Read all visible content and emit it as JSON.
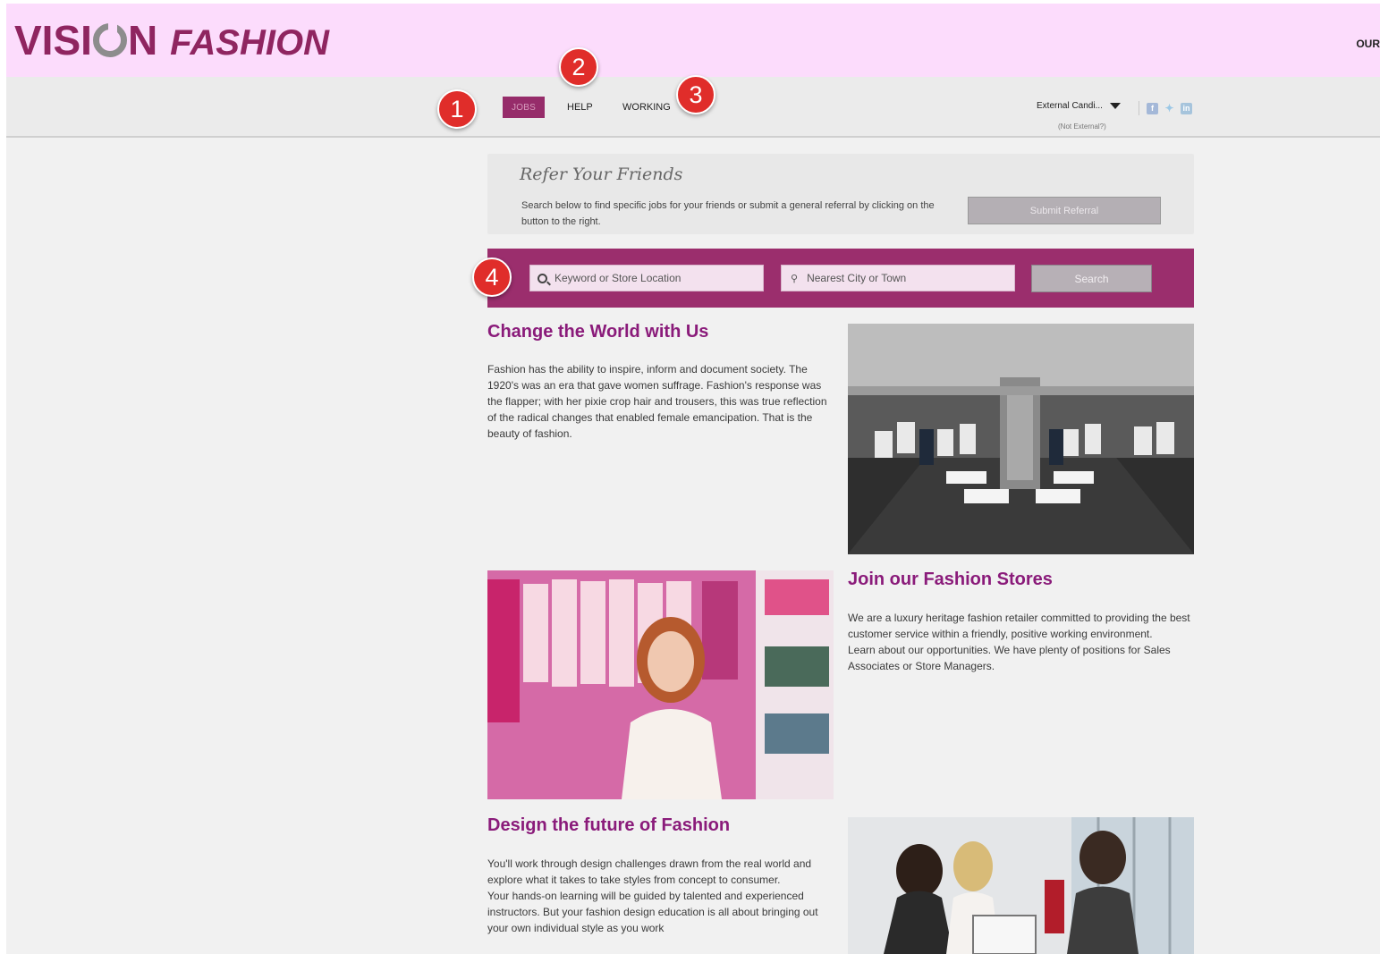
{
  "brand": {
    "name_part1": "VISI",
    "name_part2": "N",
    "name_part3": "FASHION"
  },
  "header": {
    "top_right_link": "OUR"
  },
  "nav": {
    "jobs": "JOBS",
    "help": "HELP",
    "working": "WORKING",
    "user_menu": "External Candi...",
    "not_external": "(Not External?)"
  },
  "socials": [
    "facebook-icon",
    "twitter-icon",
    "linkedin-icon"
  ],
  "markers": [
    "1",
    "2",
    "3",
    "4"
  ],
  "refer": {
    "title": "Refer Your Friends",
    "description": "Search below to find specific jobs for your friends or submit a general referral by clicking on the button to the right.",
    "button": "Submit Referral"
  },
  "search": {
    "keyword_placeholder": "Keyword or Store Location",
    "city_placeholder": "Nearest City or Town",
    "button": "Search"
  },
  "sections": [
    {
      "heading": "Change the World with Us",
      "text": "Fashion has the ability to inspire, inform and document society. The 1920's was an era that gave women suffrage. Fashion's response was the flapper; with her pixie crop hair and trousers, this was true reflection of the radical changes that enabled female emancipation. That is the beauty of fashion."
    },
    {
      "heading": "Join our Fashion Stores",
      "text1": "We are a luxury heritage fashion retailer committed to providing the best customer service within a friendly, positive working environment.",
      "text2": "Learn about our opportunities. We have plenty of positions for Sales Associates or Store Managers."
    },
    {
      "heading": "Design the future of Fashion",
      "text1": "You'll work through design challenges drawn from the real world and explore what it takes to take styles from concept to consumer.",
      "text2": "Your hands-on learning will be guided by talented and experienced instructors. But your fashion design education is all about bringing out your own individual style as you work"
    }
  ],
  "colors": {
    "brand": "#8f2560",
    "brand_bar": "#fcdcfc",
    "search_bar": "#9b2e6d",
    "heading": "#8a1b7a",
    "marker": "#e02d2a"
  }
}
